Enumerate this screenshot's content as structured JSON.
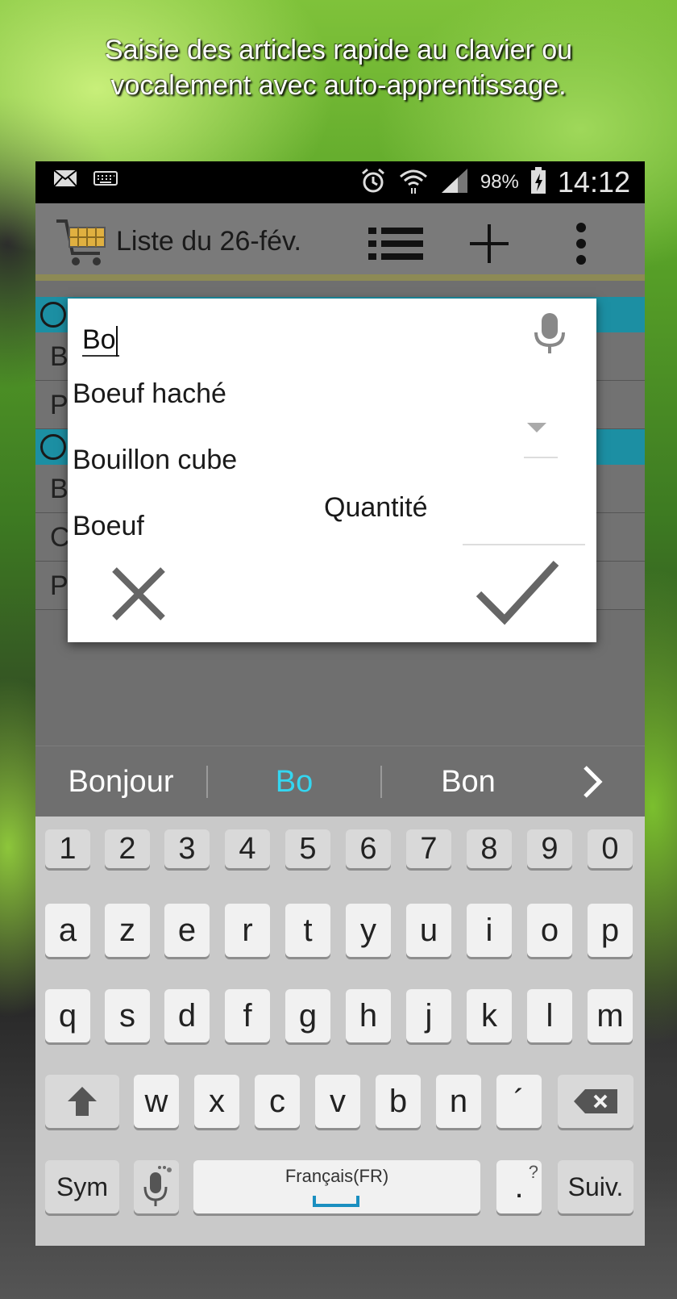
{
  "caption": {
    "line1": "Saisie des articles rapide au clavier ou",
    "line2": "vocalement avec auto-apprentissage."
  },
  "statusbar": {
    "icons_left": [
      "mail-icon",
      "keyboard-icon"
    ],
    "icons_right": [
      "alarm-icon",
      "wifi-icon",
      "signal-icon",
      "battery-icon"
    ],
    "battery": "98%",
    "time": "14:12"
  },
  "appbar": {
    "title": "Liste du 26-fév.",
    "actions": [
      "list-icon",
      "add-icon",
      "overflow-menu-icon"
    ]
  },
  "list_rows": [
    "B",
    "P",
    "B",
    "C",
    "P"
  ],
  "dialog": {
    "input_value": "Bo",
    "suggestions": [
      "Boeuf haché",
      "Bouillon cube",
      "Boeuf"
    ],
    "quantity_label": "Quantité"
  },
  "keyboard_suggestions": [
    "Bonjour",
    "Bo",
    "Bon"
  ],
  "keyboard": {
    "row_numbers": [
      "1",
      "2",
      "3",
      "4",
      "5",
      "6",
      "7",
      "8",
      "9",
      "0"
    ],
    "row1": [
      "a",
      "z",
      "e",
      "r",
      "t",
      "y",
      "u",
      "i",
      "o",
      "p"
    ],
    "row2": [
      "q",
      "s",
      "d",
      "f",
      "g",
      "h",
      "j",
      "k",
      "l",
      "m"
    ],
    "row3": [
      "w",
      "x",
      "c",
      "v",
      "b",
      "n",
      "´"
    ],
    "sym": "Sym",
    "space_label": "Français(FR)",
    "punct": ".",
    "punct_hint": "?",
    "next": "Suiv."
  },
  "colors": {
    "accent": "#1c8fa3",
    "suggestion_active": "#34d6f0"
  }
}
